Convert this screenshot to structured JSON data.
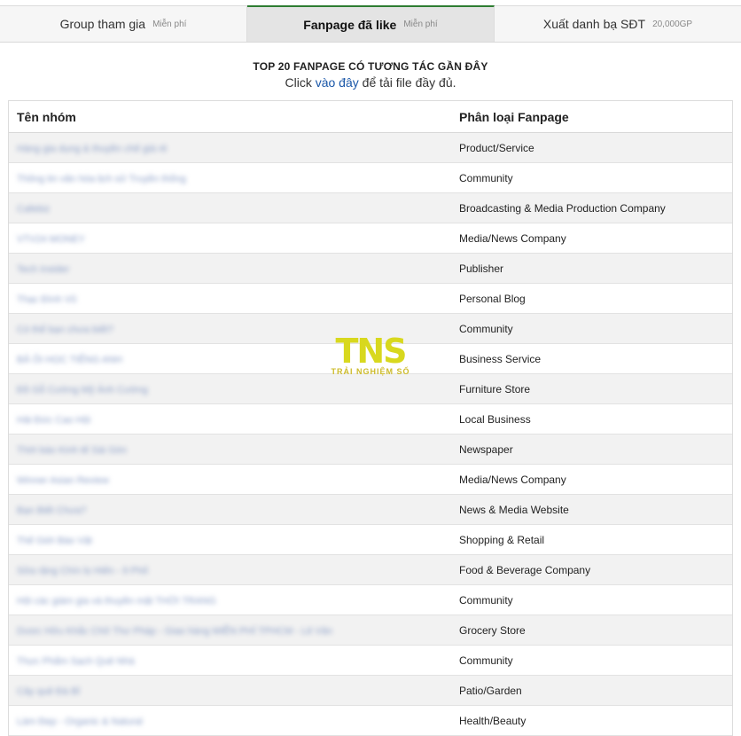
{
  "tabs": [
    {
      "label": "Group tham gia",
      "badge": "Miễn phí",
      "active": false
    },
    {
      "label": "Fanpage đã like",
      "badge": "Miễn phí",
      "active": true
    },
    {
      "label": "Xuất danh bạ SĐT",
      "badge": "20,000GP",
      "active": false
    }
  ],
  "section": {
    "title": "TOP 20 FANPAGE CÓ TƯƠNG TÁC GẦN ĐÂY",
    "line_prefix": "Click ",
    "link_text": "vào đây",
    "line_suffix": " để tải file đầy đủ."
  },
  "table": {
    "headers": [
      "Tên nhóm",
      "Phân loại Fanpage"
    ],
    "rows": [
      {
        "name": "Hàng gia dụng & thuyền chế giá rẻ",
        "category": "Product/Service"
      },
      {
        "name": "Thông tin văn hóa lịch sử Truyền thống",
        "category": "Community"
      },
      {
        "name": "Cafebiz",
        "category": "Broadcasting & Media Production Company"
      },
      {
        "name": "VTV24 MONEY",
        "category": "Media/News Company"
      },
      {
        "name": "Tech Insider",
        "category": "Publisher"
      },
      {
        "name": "Thạc Đình Vũ",
        "category": "Personal Blog"
      },
      {
        "name": "Có thể bạn chưa biết?",
        "category": "Community"
      },
      {
        "name": "BẢ ÔI HỌC TIẾNG ANH",
        "category": "Business Service"
      },
      {
        "name": "Đồ Gỗ Cường Mỹ Ánh Cường",
        "category": "Furniture Store"
      },
      {
        "name": "Hải Đức Cao Hội",
        "category": "Local Business"
      },
      {
        "name": "Thời báo Kinh tế Sài Gòn",
        "category": "Newspaper"
      },
      {
        "name": "Winner Asian Review",
        "category": "Media/News Company"
      },
      {
        "name": "Bạn Biết Chưa?",
        "category": "News & Media Website"
      },
      {
        "name": "Thế Giới Báo Vật",
        "category": "Shopping & Retail"
      },
      {
        "name": "Sữa rặng Chín lọ Hiến - 9 Phố",
        "category": "Food & Beverage Company"
      },
      {
        "name": "Hội các giám gia và thuyền mặt THỜI TRANG",
        "category": "Community"
      },
      {
        "name": "Dược Hữu Khắc Chữ Thư Pháp - Giao hàng MIỄN PHÍ TPHCM - Lê Văn",
        "category": "Grocery Store"
      },
      {
        "name": "Thực Phẩm Sạch Quê Nhà",
        "category": "Community"
      },
      {
        "name": "Cây quê Đà Bỉ",
        "category": "Patio/Garden"
      },
      {
        "name": "Làm Đẹp - Organic & Natural",
        "category": "Health/Beauty"
      }
    ]
  },
  "watermark": {
    "logo": "TNS",
    "tagline": "TRẢI NGHIỆM SỐ"
  },
  "colors": {
    "active_tab_border": "#2e7d32",
    "link": "#1a57a8",
    "stripe": "#f2f2f2"
  }
}
